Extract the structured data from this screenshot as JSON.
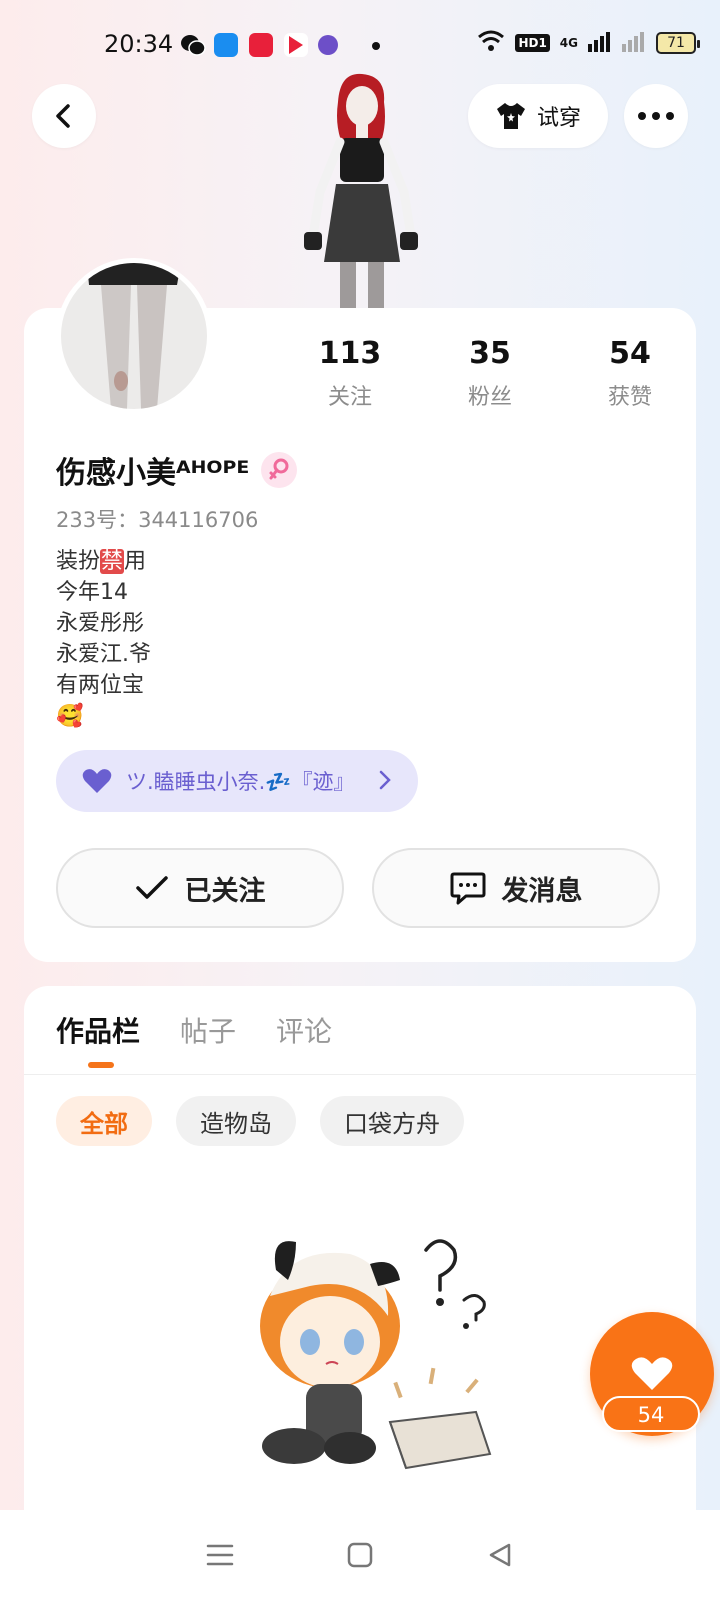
{
  "status_bar": {
    "time": "20:34",
    "network_label": "4G",
    "hd_label": "HD1",
    "battery": "71"
  },
  "top_nav": {
    "tryon_label": "试穿"
  },
  "profile": {
    "stats": [
      {
        "value": "113",
        "label": "关注"
      },
      {
        "value": "35",
        "label": "粉丝"
      },
      {
        "value": "54",
        "label": "获赞"
      }
    ],
    "username": "伤感小美ᴬᴴᴼᴾᴱ",
    "user_id": "233号：344116706",
    "bio_line1_before": "装扮",
    "bio_forbid": "禁",
    "bio_line1_after": "用",
    "bio_rest": "今年14\n永爱彤彤\n永爱江.爷\n有两位宝\n🥰",
    "guild_label": "ツ.瞌睡虫小奈.💤『迹』",
    "followed_label": "已关注",
    "message_label": "发消息"
  },
  "content": {
    "tabs": [
      "作品栏",
      "帖子",
      "评论"
    ],
    "active_tab": 0,
    "filters": [
      "全部",
      "造物岛",
      "口袋方舟"
    ],
    "active_filter": 0,
    "like_count": "54"
  },
  "colors": {
    "accent": "#f97316",
    "guild_bg": "#e7e6fb",
    "guild_text": "#6a5fd0"
  }
}
